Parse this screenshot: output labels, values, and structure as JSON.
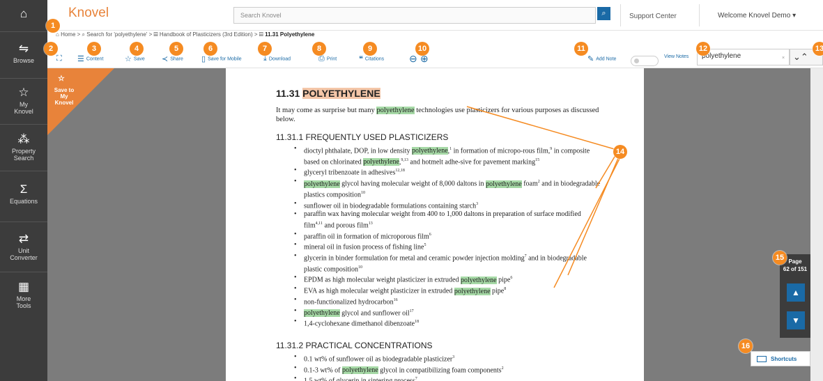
{
  "nav": {
    "home": "",
    "browse": "Browse",
    "my_knovel": "My Knovel",
    "property_search": "Property Search",
    "equations": "Equations",
    "unit_converter": "Unit Converter",
    "more_tools": "More Tools"
  },
  "header": {
    "logo": "Knovel",
    "search_placeholder": "Search Knovel",
    "support": "Support Center",
    "welcome": "Welcome Knovel Demo"
  },
  "breadcrumb": {
    "home": "Home",
    "search": "Search for 'polyethylene'",
    "book": "Handbook of Plasticizers (3rd Edition)",
    "current": "11.31 Polyethylene"
  },
  "toolbar": {
    "content": "Content",
    "save": "Save",
    "share": "Share",
    "save_mobile": "Save for Mobile",
    "download": "Download",
    "print": "Print",
    "citations": "Citations",
    "add_note": "Add Note",
    "view_notes": "View Notes",
    "find_value": "polyethylene"
  },
  "save_tag": "Save to My Knovel",
  "doc": {
    "title_num": "11.31",
    "title_word": "POLYETHYLENE",
    "intro_a": "It may come as surprise but many",
    "intro_hl": "polyethylene",
    "intro_b": "technologies use plasticizers for various purposes as discussed below.",
    "sec1": "11.31.1 FREQUENTLY USED PLASTICIZERS",
    "sec2": "11.31.2 PRACTICAL CONCENTRATIONS"
  },
  "page_nav": {
    "label": "Page",
    "value": "62 of 151"
  },
  "shortcuts": "Shortcuts",
  "callouts": [
    "1",
    "2",
    "3",
    "4",
    "5",
    "6",
    "7",
    "8",
    "9",
    "10",
    "11",
    "12",
    "13",
    "14",
    "15",
    "16"
  ],
  "colors": {
    "accent_orange": "#e8833a",
    "callout": "#f58b22",
    "link_blue": "#1a6aa6",
    "highlight_green": "#a6d9a6",
    "nav_dark": "#3c3c3c"
  }
}
